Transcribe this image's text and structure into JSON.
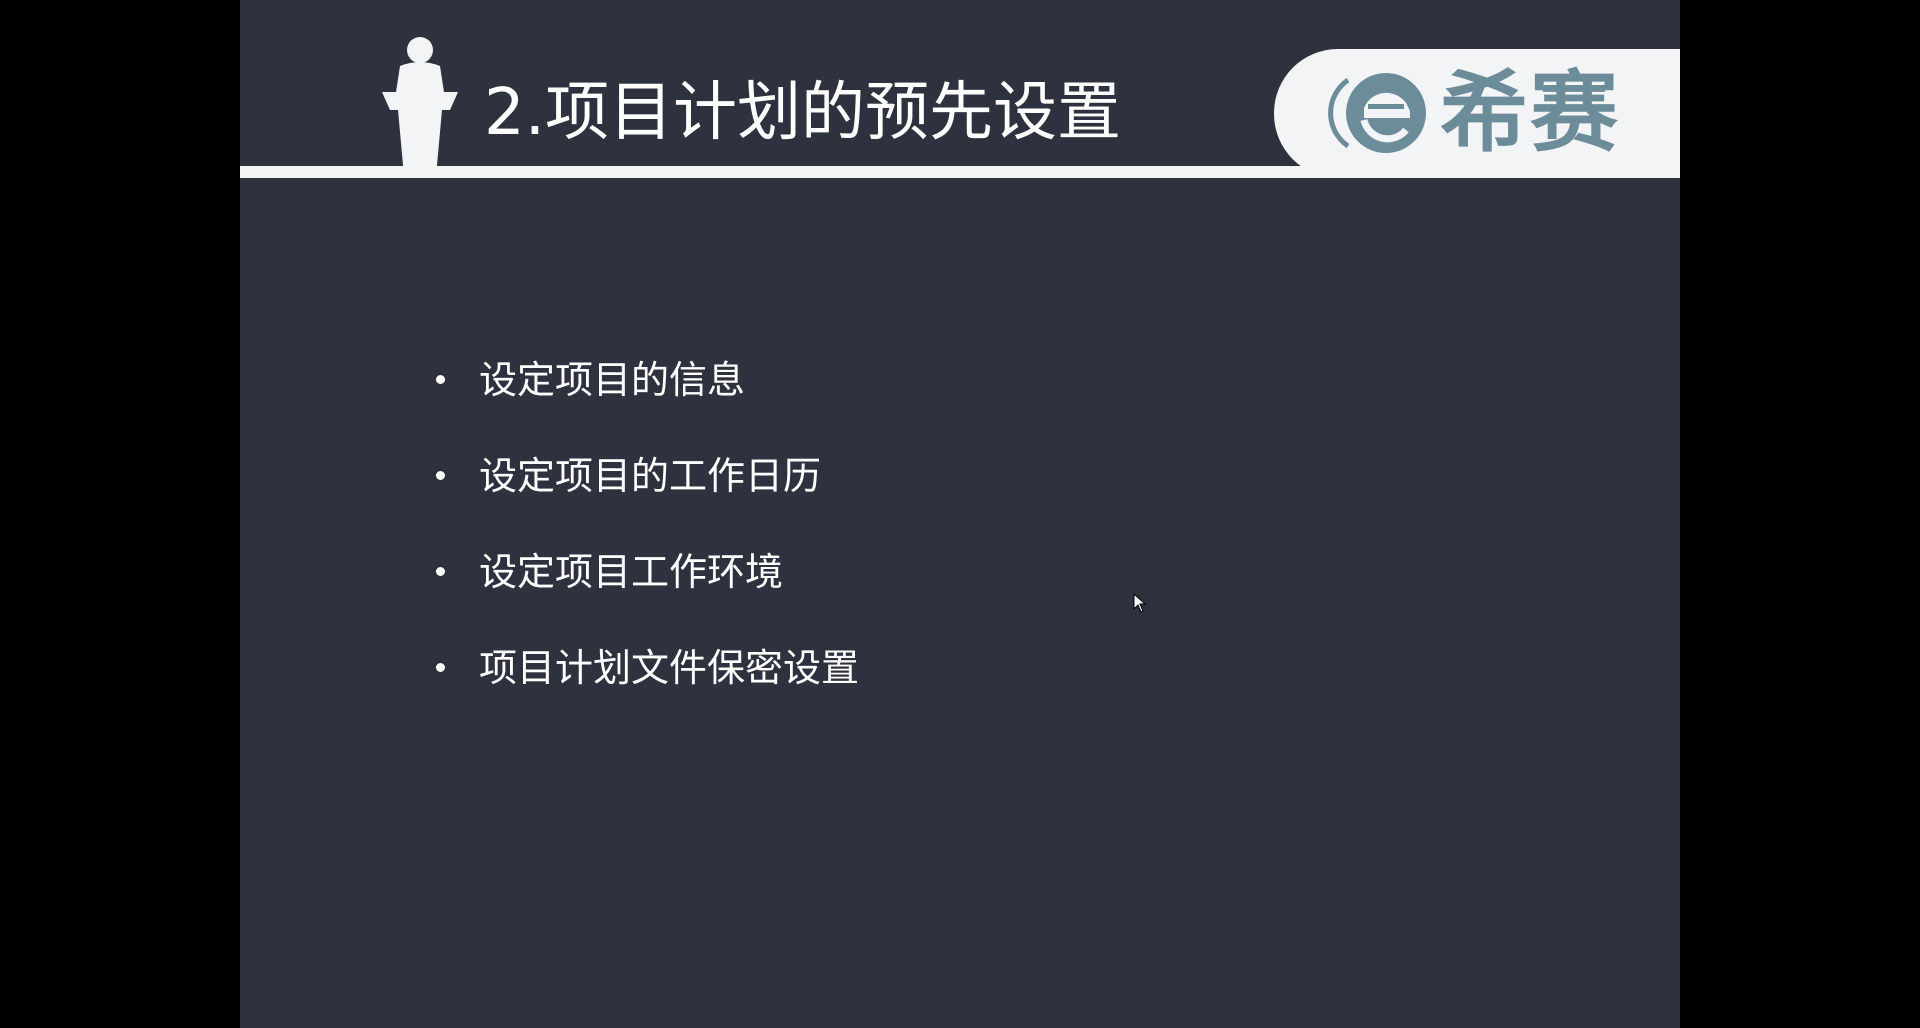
{
  "slide": {
    "title": "2.项目计划的预先设置",
    "logo": {
      "text": "希赛",
      "color": "#6c8c9a"
    },
    "bullets": [
      "设定项目的信息",
      "设定项目的工作日历",
      "设定项目工作环境",
      "项目计划文件保密设置"
    ],
    "colors": {
      "background": "#2e323e",
      "band": "#f3f4f6",
      "text": "#ffffff"
    }
  },
  "icons": {
    "speaker": "speaker-podium-icon",
    "logo_mark": "e-logo-icon",
    "cursor": "mouse-cursor-icon"
  }
}
